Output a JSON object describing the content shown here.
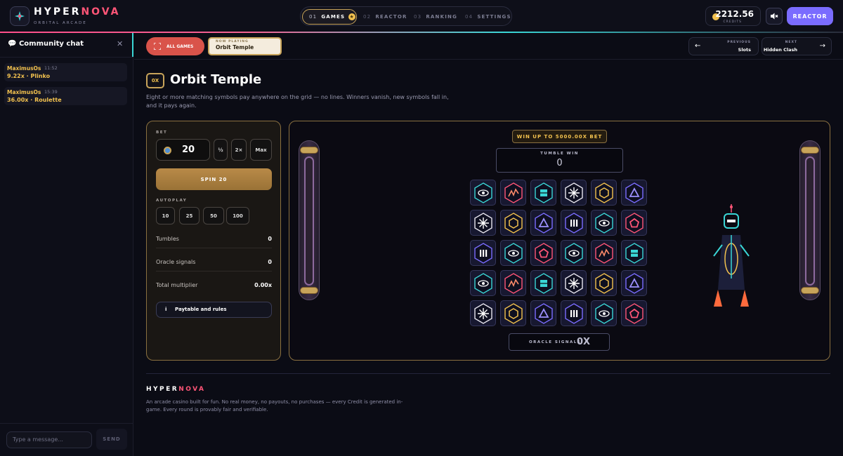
{
  "brand": {
    "name_a": "HYPER",
    "name_b": "NOVA",
    "tagline": "ORBITAL ARCADE"
  },
  "nav": {
    "tabs": [
      {
        "num": "01",
        "label": "GAMES",
        "active": true
      },
      {
        "num": "02",
        "label": "REACTOR"
      },
      {
        "num": "03",
        "label": "RANKING"
      },
      {
        "num": "04",
        "label": "SETTINGS"
      }
    ]
  },
  "wallet": {
    "credits": "2212.56",
    "label": "CREDITS"
  },
  "header_actions": {
    "reactor_label": "REACTOR",
    "mute_icon": "speaker-muted-icon"
  },
  "chat": {
    "title": "Community chat",
    "messages": [
      {
        "user": "MaximusOs",
        "time": "11:52",
        "text": "9.22x · Plinko"
      },
      {
        "user": "MaximusOs",
        "time": "15:39",
        "text": "36.00x · Roulette"
      }
    ],
    "input_placeholder": "Type a message...",
    "send_label": "SEND"
  },
  "subbar": {
    "all_games": "ALL GAMES",
    "now_playing_label": "NOW PLAYING",
    "now_playing": "Orbit Temple",
    "previous_label": "PREVIOUS",
    "previous": "Slots",
    "next_label": "NEXT",
    "next": "Hidden Clash"
  },
  "game": {
    "multiplier_badge": "0X",
    "title": "Orbit Temple",
    "description": "Eight or more matching symbols pay anywhere on the grid — no lines. Winners vanish, new symbols fall in, and it pays again."
  },
  "controls": {
    "bet_label": "BET",
    "bet_value": "20",
    "half": "½",
    "double": "2×",
    "max": "Max",
    "spin_label": "SPIN 20",
    "autoplay_label": "AUTOPLAY",
    "autoplay": [
      "10",
      "25",
      "50",
      "100"
    ],
    "stats": [
      {
        "label": "Tumbles",
        "value": "0"
      },
      {
        "label": "Oracle signals",
        "value": "0"
      },
      {
        "label": "Total multiplier",
        "value": "0.00x"
      }
    ],
    "paytable": "Paytable and rules"
  },
  "board": {
    "win_up_to": "WIN UP TO 5000.00X BET",
    "tumble_label": "TUMBLE WIN",
    "tumble_value": "0",
    "oracle_label": "ORACLE SIGNALS",
    "oracle_value": "0X",
    "grid": [
      [
        "eye",
        "zigzag",
        "square",
        "star",
        "hexagon",
        "triangle"
      ],
      [
        "star",
        "hexagon",
        "triangle",
        "bars",
        "eye",
        "pentagon"
      ],
      [
        "bars",
        "eye",
        "pentagon",
        "eye",
        "zigzag",
        "square"
      ],
      [
        "eye",
        "zigzag",
        "square",
        "star",
        "hexagon",
        "triangle"
      ],
      [
        "star",
        "hexagon",
        "triangle",
        "bars",
        "eye",
        "pentagon"
      ]
    ]
  },
  "colors": {
    "accent_gold": "#c8a45a",
    "accent_purple": "#7a6cff",
    "brand_pink": "#ff5577",
    "chat_gold": "#f2c14e"
  },
  "footer": {
    "brand_a": "HYPER",
    "brand_b": "NOVA",
    "text": "An arcade casino built for fun. No real money, no payouts, no purchases — every Credit is generated in-game. Every round is provably fair and verifiable."
  }
}
